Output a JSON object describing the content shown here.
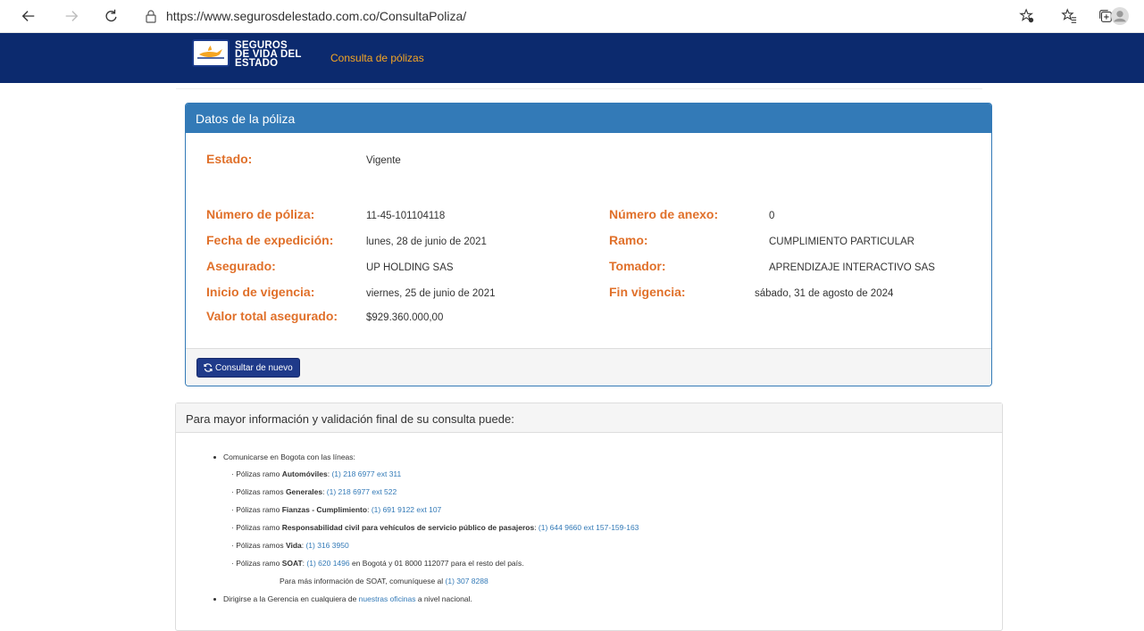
{
  "browser": {
    "url": "https://www.segurosdelestado.com.co/ConsultaPoliza/"
  },
  "header": {
    "logo_line1": "SEGUROS",
    "logo_line2": "DE VIDA DEL",
    "logo_line3": "ESTADO",
    "title": "Consulta de pólizas"
  },
  "policy": {
    "panel_title": "Datos de la póliza",
    "estado_label": "Estado:",
    "estado_value": "Vigente",
    "numero_poliza_label": "Número de póliza:",
    "numero_poliza_value": "11-45-101104118",
    "numero_anexo_label": "Número de anexo:",
    "numero_anexo_value": "0",
    "fecha_expedicion_label": "Fecha de expedición:",
    "fecha_expedicion_value": "lunes, 28 de junio de 2021",
    "ramo_label": "Ramo:",
    "ramo_value": "CUMPLIMIENTO PARTICULAR",
    "asegurado_label": "Asegurado:",
    "asegurado_value": "UP HOLDING SAS",
    "tomador_label": "Tomador:",
    "tomador_value": "APRENDIZAJE INTERACTIVO SAS",
    "inicio_vigencia_label": "Inicio de vigencia:",
    "inicio_vigencia_value": "viernes, 25 de junio de 2021",
    "fin_vigencia_label": "Fin vigencia:",
    "fin_vigencia_value": "sábado, 31 de agosto de 2024",
    "valor_label": "Valor total asegurado:",
    "valor_value": "$929.360.000,00",
    "button_label": "Consultar de nuevo"
  },
  "info": {
    "title": "Para mayor información y validación final de su consulta puede:",
    "bullet1": "Comunicarse en Bogota con las líneas:",
    "auto_prefix": "· Pólizas ramo ",
    "auto_bold": "Automóviles",
    "auto_phone": "(1) 218 6977 ext 311",
    "gen_prefix": "· Pólizas ramos ",
    "gen_bold": "Generales",
    "gen_phone": "(1) 218 6977 ext 522",
    "fianzas_prefix": "· Pólizas ramo ",
    "fianzas_bold": "Fianzas - Cumplimiento",
    "fianzas_phone": "(1) 691 9122 ext 107",
    "resp_prefix": "· Pólizas ramo ",
    "resp_bold": "Responsabilidad civil para vehículos de servicio público de pasajeros",
    "resp_phone": "(1) 644 9660 ext 157-159-163",
    "vida_prefix": "· Pólizas ramos ",
    "vida_bold": "Vida",
    "vida_phone": "(1) 316 3950",
    "soat_prefix": "· Pólizas ramo ",
    "soat_bold": "SOAT",
    "soat_phone": "(1) 620 1496",
    "soat_suffix": " en Bogotá y 01 8000 112077 para el resto del país.",
    "soat_more_text": "Para más información de SOAT, comuníquese al ",
    "soat_more_phone": "(1) 307 8288",
    "bullet2_prefix": "Dirigirse a la Gerencia en cualquiera de ",
    "bullet2_link": "nuestras oficinas",
    "bullet2_suffix": " a nivel nacional.",
    "colon": ": "
  }
}
